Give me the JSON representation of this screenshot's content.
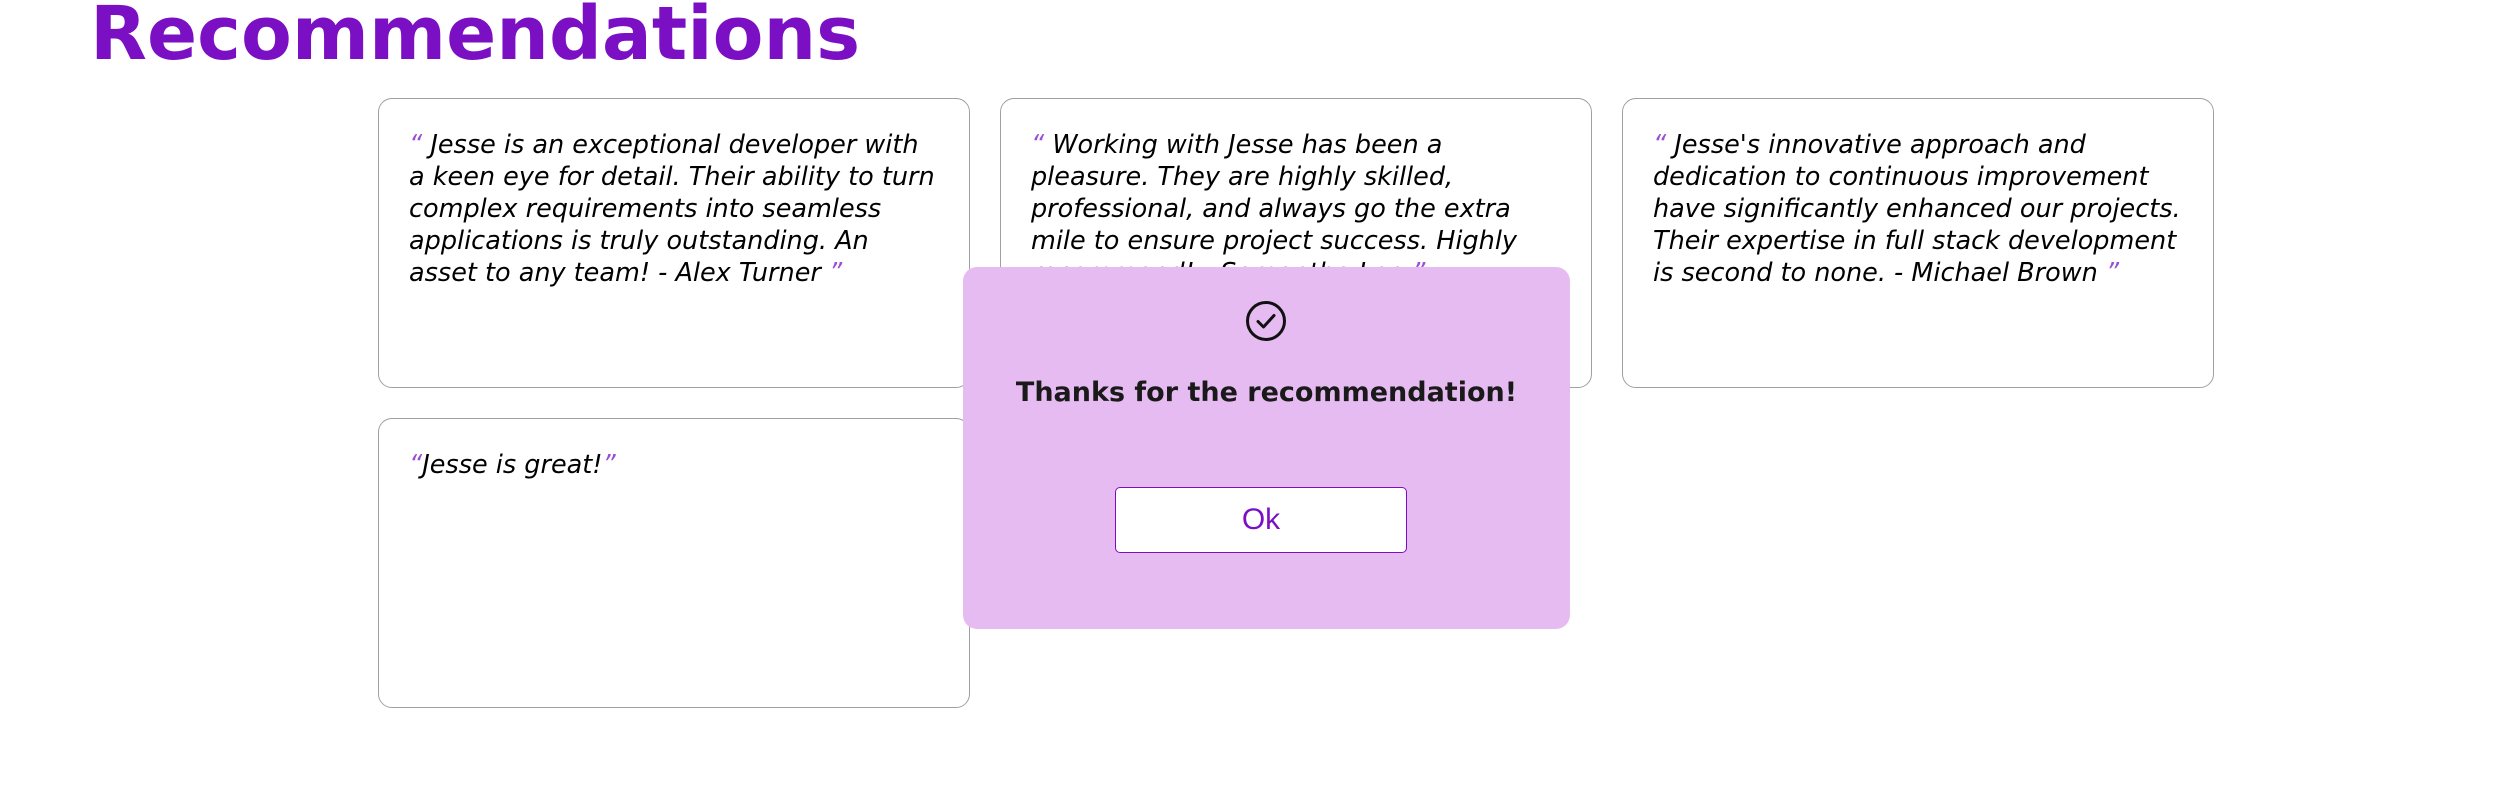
{
  "page": {
    "title": "Recommendations"
  },
  "recommendations": [
    {
      "open_quote": "“",
      "text": " Jesse is an exceptional developer with a keen eye for detail. Their ability to turn complex requirements into seamless applications is truly outstanding. An asset to any team! - Alex Turner ",
      "close_quote": "”"
    },
    {
      "open_quote": "“",
      "text": " Working with Jesse has been a pleasure. They are highly skilled, professional, and always go the extra mile to ensure project success. Highly recommend! - Samantha Lee ",
      "close_quote": "”"
    },
    {
      "open_quote": "“",
      "text": " Jesse's innovative approach and dedication to continuous improvement have significantly enhanced our projects. Their expertise in full stack development is second to none. - Michael Brown ",
      "close_quote": "”"
    },
    {
      "open_quote": "“",
      "text": "Jesse is great!",
      "close_quote": "”"
    }
  ],
  "modal": {
    "icon": "check-circle-icon",
    "message": "Thanks for the recommendation!",
    "ok_label": "Ok"
  },
  "colors": {
    "accent": "#7b0fc3",
    "quote_mark": "#9a4fd6",
    "modal_background": "#e6bbf1",
    "card_border": "#a0a0a0"
  }
}
